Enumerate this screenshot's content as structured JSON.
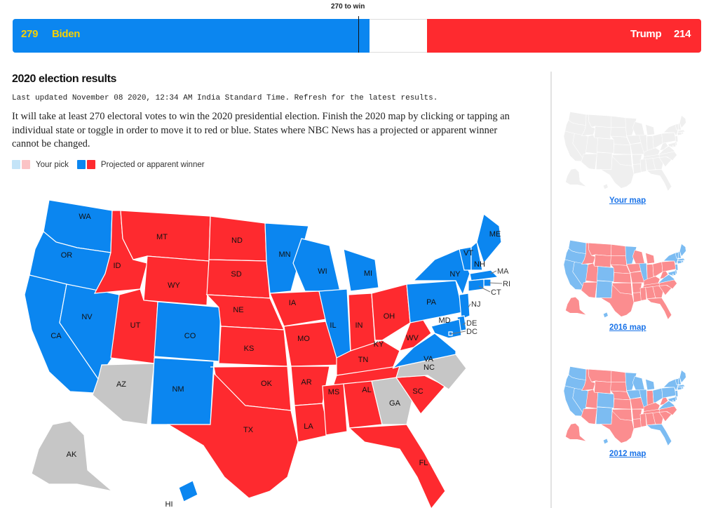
{
  "scoreboard": {
    "threshold_label": "270 to win",
    "threshold": 270,
    "total": 538,
    "biden": {
      "name": "Biden",
      "votes": "279",
      "value": 279,
      "color": "#0b86f0"
    },
    "trump": {
      "name": "Trump",
      "votes": "214",
      "value": 214,
      "color": "#fe2a2f"
    }
  },
  "header": {
    "title": "2020 election results",
    "updated": "Last updated November 08 2020, 12:34 AM India Standard Time. Refresh for the latest results.",
    "description": "It will take at least 270 electoral votes to win the 2020 presidential election. Finish the 2020 map by clicking or tapping an individual state or toggle in order to move it to red or blue. States where NBC News has a projected or apparent winner cannot be changed."
  },
  "legend": {
    "your_pick": {
      "label": "Your pick",
      "colors": [
        "#c4e4f8",
        "#fbc3c5"
      ]
    },
    "projected": {
      "label": "Projected or apparent winner",
      "colors": [
        "#0b86f0",
        "#fe2a2f"
      ]
    }
  },
  "colors": {
    "dem": "#0b86f0",
    "rep": "#fe2a2f",
    "undecided": "#c6c6c6",
    "light_dem": "#7cbcf2",
    "light_rep": "#fb8d8f",
    "blank": "#efefef"
  },
  "states": {
    "WA": "D",
    "OR": "D",
    "CA": "D",
    "NV": "D",
    "ID": "R",
    "MT": "R",
    "WY": "R",
    "UT": "R",
    "CO": "D",
    "AZ": "U",
    "NM": "D",
    "ND": "R",
    "SD": "R",
    "NE": "R",
    "KS": "R",
    "OK": "R",
    "TX": "R",
    "MN": "D",
    "IA": "R",
    "MO": "R",
    "AR": "R",
    "LA": "R",
    "WI": "D",
    "IL": "D",
    "MI": "D",
    "IN": "R",
    "OH": "R",
    "KY": "R",
    "TN": "R",
    "MS": "R",
    "AL": "R",
    "GA": "U",
    "FL": "R",
    "SC": "R",
    "NC": "U",
    "VA": "D",
    "WV": "R",
    "PA": "D",
    "NY": "D",
    "VT": "D",
    "NH": "D",
    "ME": "D",
    "MA": "D",
    "RI": "D",
    "CT": "D",
    "NJ": "D",
    "DE": "D",
    "MD": "D",
    "DC": "D",
    "AK": "U",
    "HI": "D"
  },
  "sidebar": {
    "maps": [
      {
        "label": "Your map",
        "style": "blank"
      },
      {
        "label": "2016 map",
        "style": "2016"
      },
      {
        "label": "2012 map",
        "style": "2012"
      }
    ],
    "results_2016": {
      "R": [
        "ID",
        "MT",
        "WY",
        "UT",
        "AZ",
        "ND",
        "SD",
        "NE",
        "KS",
        "OK",
        "TX",
        "IA",
        "MO",
        "AR",
        "LA",
        "WI",
        "MI",
        "IN",
        "OH",
        "KY",
        "TN",
        "MS",
        "AL",
        "GA",
        "FL",
        "SC",
        "NC",
        "WV",
        "PA",
        "AK"
      ]
    },
    "results_2012": {
      "R": [
        "ID",
        "MT",
        "WY",
        "UT",
        "AZ",
        "ND",
        "SD",
        "NE",
        "KS",
        "OK",
        "TX",
        "MO",
        "AR",
        "LA",
        "IN",
        "KY",
        "TN",
        "MS",
        "AL",
        "GA",
        "SC",
        "NC",
        "WV",
        "AK"
      ]
    }
  }
}
